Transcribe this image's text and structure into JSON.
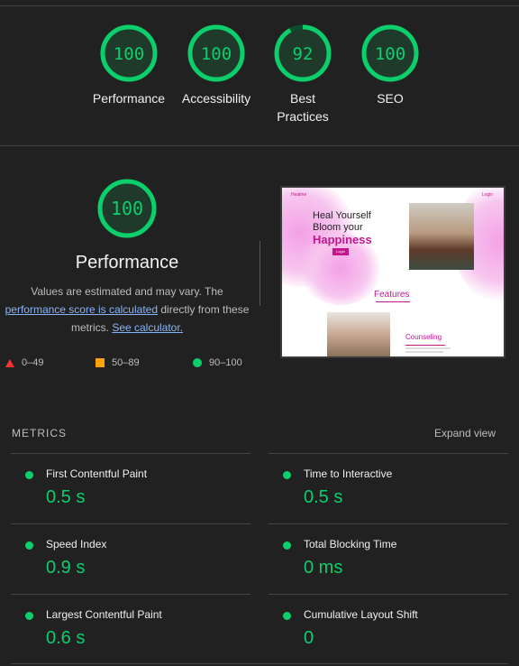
{
  "colors": {
    "pass": "#0cce6b",
    "average": "#ffa400",
    "fail": "#ff3333"
  },
  "categories": [
    {
      "score": 100,
      "label": "Performance"
    },
    {
      "score": 100,
      "label": "Accessibility"
    },
    {
      "score": 92,
      "label": "Best Practices"
    },
    {
      "score": 100,
      "label": "SEO"
    }
  ],
  "performance": {
    "score": 100,
    "title": "Performance",
    "desc_text1": "Values are estimated and may vary. The",
    "desc_link1": "performance score is calculated",
    "desc_text2": "directly from these metrics.",
    "desc_link2": "See calculator."
  },
  "legend": [
    {
      "icon": "fail-triangle-icon",
      "range": "0–49"
    },
    {
      "icon": "average-square-icon",
      "range": "50–89"
    },
    {
      "icon": "pass-circle-icon",
      "range": "90–100"
    }
  ],
  "thumbnail": {
    "brand": "Healme",
    "login": "Login",
    "line1": "Heal Yourself",
    "line2": "Bloom your",
    "line3": "Happiness",
    "button": "Login",
    "features": "Features",
    "counseling": "Counseling"
  },
  "metrics_header": "METRICS",
  "expand_label": "Expand view",
  "metrics": [
    {
      "name": "First Contentful Paint",
      "value": "0.5 s"
    },
    {
      "name": "Time to Interactive",
      "value": "0.5 s"
    },
    {
      "name": "Speed Index",
      "value": "0.9 s"
    },
    {
      "name": "Total Blocking Time",
      "value": "0 ms"
    },
    {
      "name": "Largest Contentful Paint",
      "value": "0.6 s"
    },
    {
      "name": "Cumulative Layout Shift",
      "value": "0"
    }
  ]
}
